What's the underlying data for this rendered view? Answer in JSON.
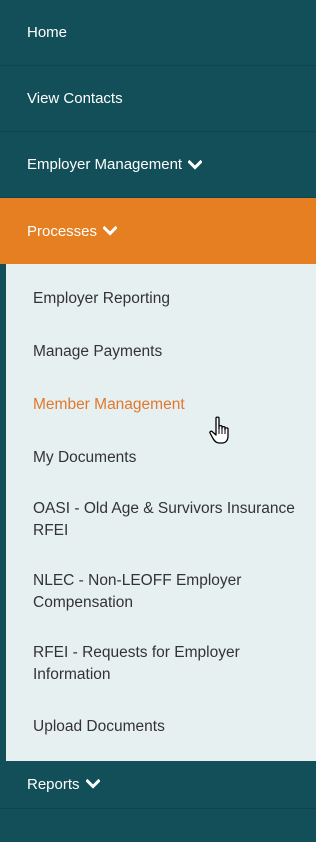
{
  "nav": {
    "home": "Home",
    "view_contacts": "View Contacts",
    "employer_management": "Employer Management",
    "processes": "Processes",
    "reports": "Reports"
  },
  "submenu": {
    "items": [
      "Employer Reporting",
      "Manage Payments",
      "Member Management",
      "My Documents",
      "OASI - Old Age & Survivors Insurance RFEI",
      "NLEC - Non-LEOFF Employer Compensation",
      "RFEI - Requests for Employer Information",
      "Upload Documents"
    ],
    "selected": "Member Management"
  },
  "colors": {
    "nav_bg": "#124f59",
    "active_bg": "#e67e22",
    "submenu_bg": "#e7f0f1",
    "selected_text": "#e0782e"
  },
  "icons": {
    "chevron": "chevron-down-icon",
    "cursor": "hand-pointer-cursor-icon"
  }
}
